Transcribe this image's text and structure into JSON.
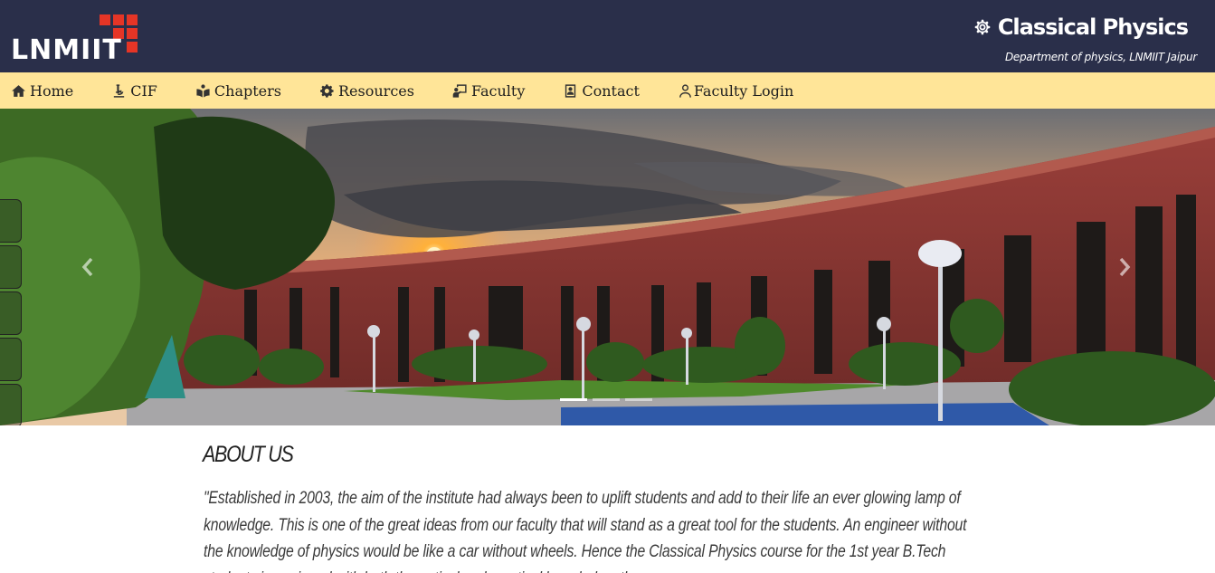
{
  "header": {
    "logo_text": "LNMIIT",
    "title": "Classical Physics",
    "subtitle": "Department of physics, LNMIIT Jaipur",
    "brand_icon": "gear-icon"
  },
  "nav": {
    "items": [
      {
        "label": "Home",
        "icon": "home-icon"
      },
      {
        "label": "CIF",
        "icon": "microscope-icon"
      },
      {
        "label": "Chapters",
        "icon": "book-reader-icon"
      },
      {
        "label": "Resources",
        "icon": "gear-icon"
      },
      {
        "label": "Faculty",
        "icon": "chalkboard-teacher-icon"
      },
      {
        "label": "Contact",
        "icon": "contact-card-icon"
      },
      {
        "label": "Faculty Login",
        "icon": "user-icon"
      }
    ]
  },
  "carousel": {
    "prev_icon": "chevron-left-icon",
    "next_icon": "chevron-right-icon",
    "active_index": 0,
    "slide_count": 3
  },
  "about": {
    "title": "ABOUT US",
    "text": "\"Established in 2003, the aim of the institute had always been to uplift students and add to their life an ever glowing lamp of knowledge. This is one of the great ideas from our faculty that will stand as a great tool for the students. An engineer without the knowledge of physics would be like a car without wheels. Hence the Classical Physics course for the 1st year B.Tech students is equipped with both theoretical and practical knowledge, thus"
  },
  "colors": {
    "header_bg": "#2a2f4a",
    "nav_bg": "#ffe598",
    "logo_red": "#e53526"
  }
}
